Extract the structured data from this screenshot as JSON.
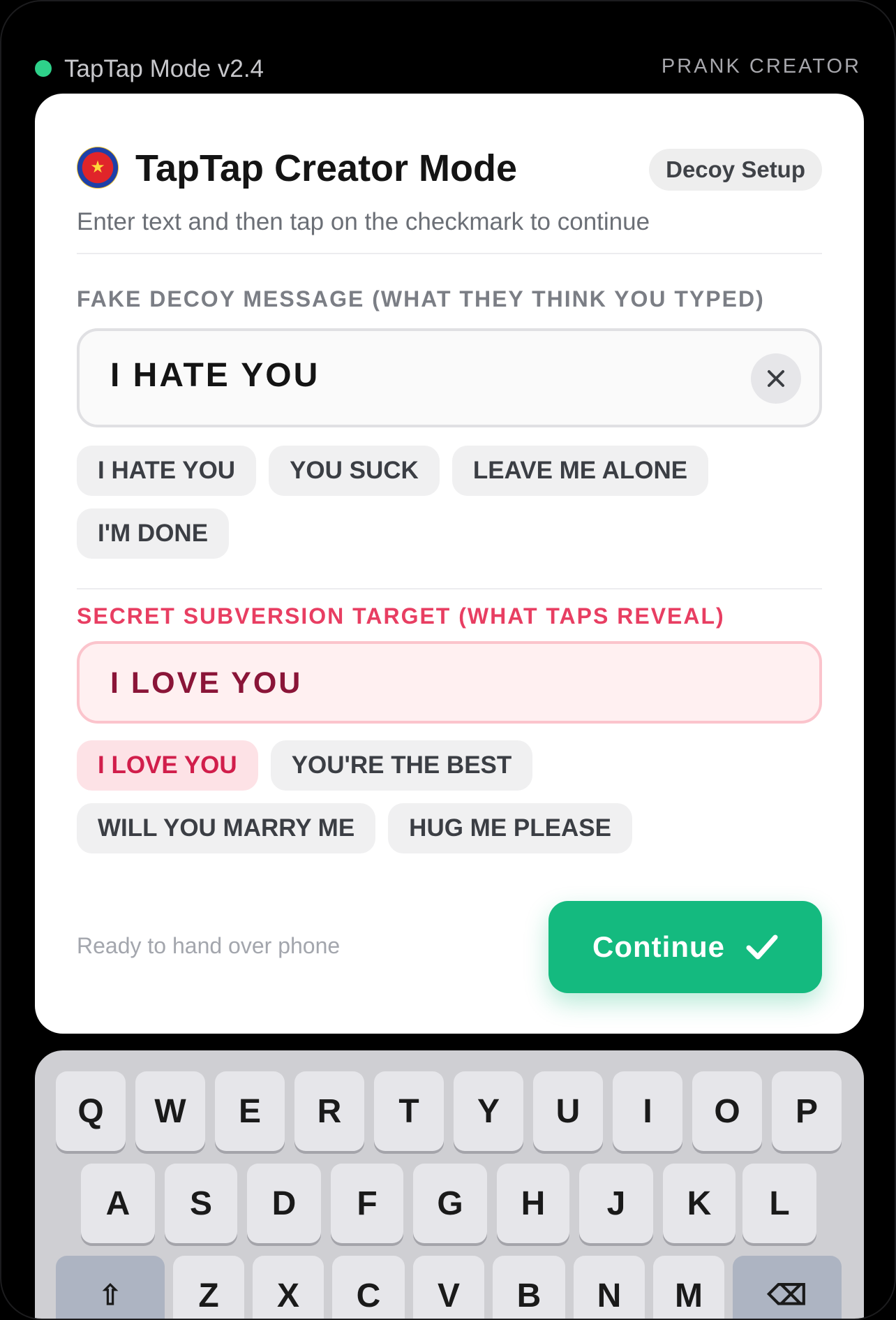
{
  "status_bar": {
    "app_version": "TapTap Mode v2.4",
    "mode_label": "PRANK CREATOR",
    "status_dot_color": "#2ed18a"
  },
  "card": {
    "logo_icon": "badge-logo",
    "title": "TapTap Creator Mode",
    "decoy_setup_label": "Decoy Setup",
    "subtitle": "Enter text and then tap on the checkmark to continue"
  },
  "fake_section": {
    "label": "FAKE DECOY MESSAGE (WHAT THEY THINK YOU TYPED)",
    "value": "I HATE YOU",
    "clear_icon": "close-icon",
    "suggestions": [
      "I HATE YOU",
      "YOU SUCK",
      "LEAVE ME ALONE",
      "I'M DONE"
    ]
  },
  "secret_section": {
    "label": "SECRET SUBVERSION TARGET (WHAT TAPS REVEAL)",
    "value": "I LOVE YOU",
    "accent_color": "#e83e62",
    "suggestions": [
      "I LOVE YOU",
      "YOU'RE THE BEST",
      "WILL YOU MARRY ME",
      "HUG ME PLEASE"
    ],
    "selected": "I LOVE YOU"
  },
  "footer": {
    "status_text": "Ready to hand over phone",
    "continue_label": "Continue",
    "continue_icon": "checkmark-icon",
    "continue_color": "#14ba7f"
  },
  "keyboard": {
    "row1": [
      "Q",
      "W",
      "E",
      "R",
      "T",
      "Y",
      "U",
      "I",
      "O",
      "P"
    ],
    "row2": [
      "A",
      "S",
      "D",
      "F",
      "G",
      "H",
      "J",
      "K",
      "L"
    ],
    "row3": [
      "Z",
      "X",
      "C",
      "V",
      "B",
      "N",
      "M"
    ],
    "shift_key": "⇧",
    "backspace_key": "⌫"
  }
}
